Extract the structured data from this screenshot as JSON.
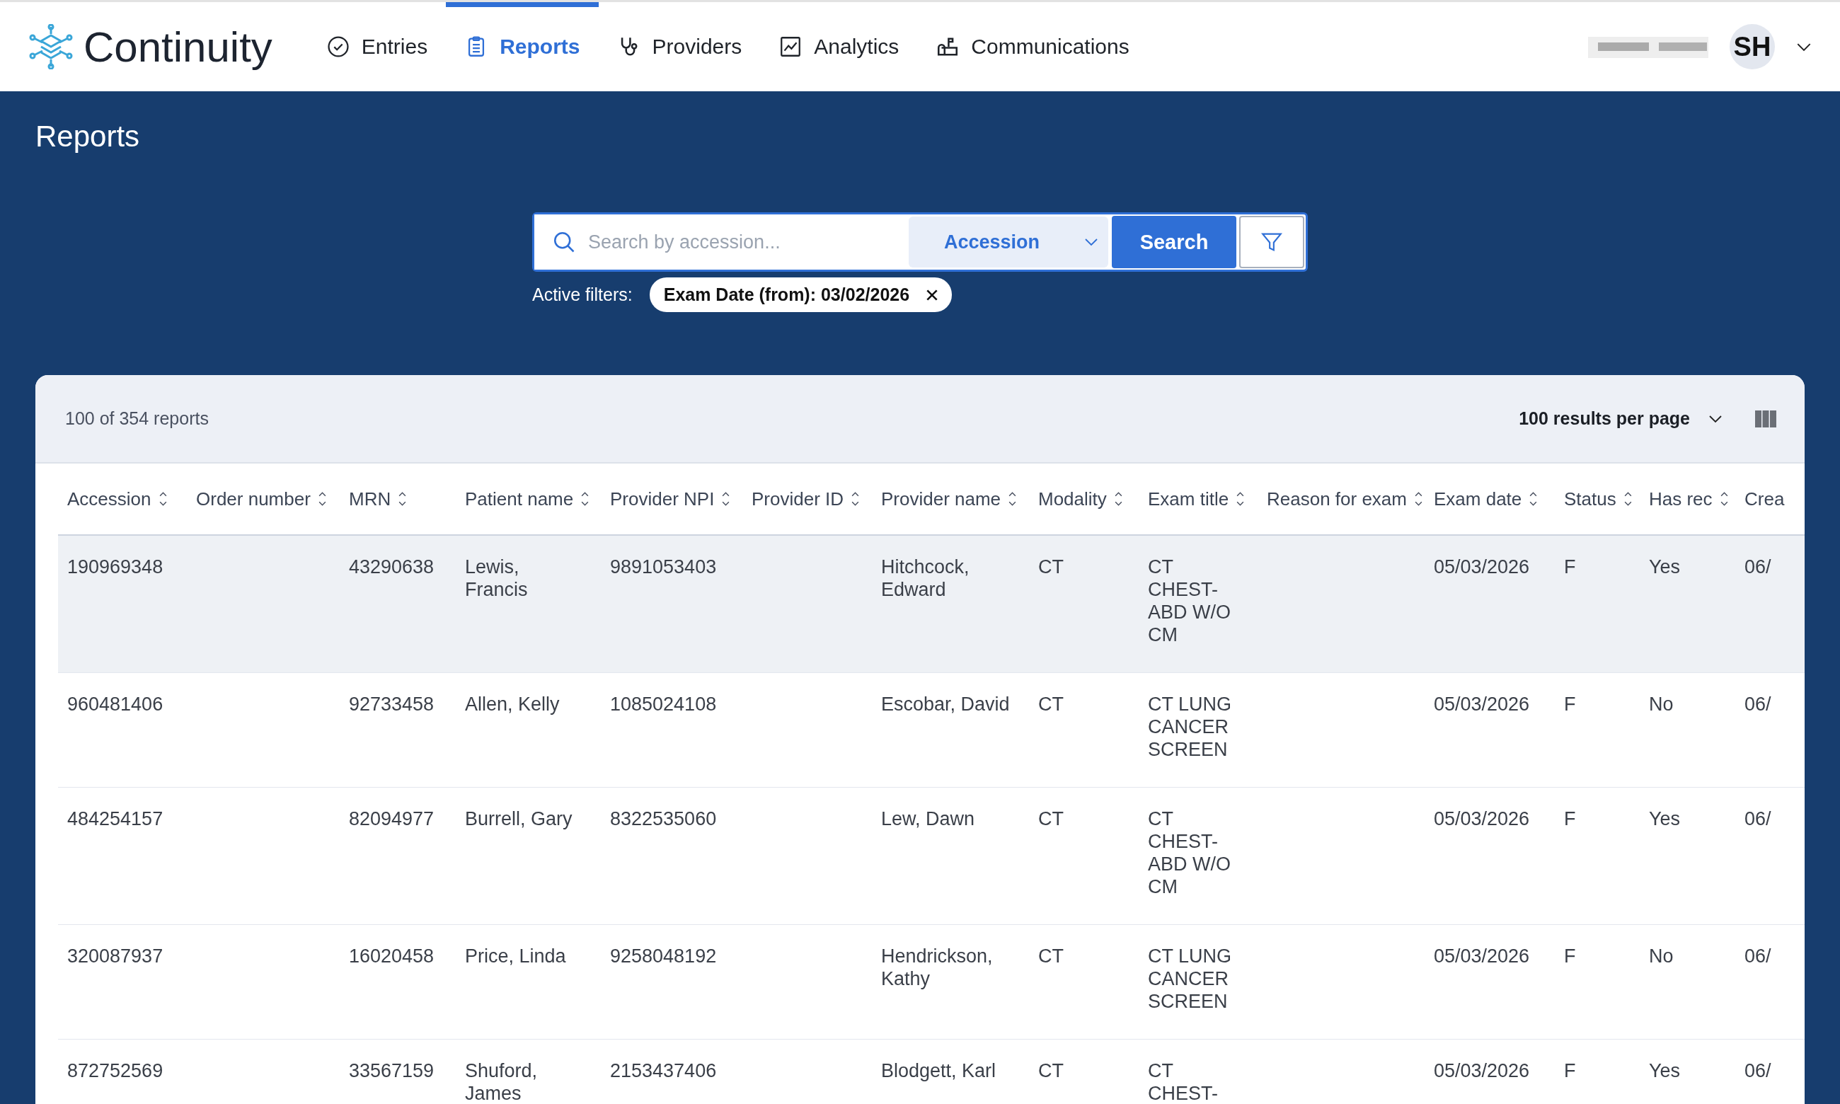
{
  "app": {
    "name": "Continuity",
    "user_initials": "SH"
  },
  "nav": [
    {
      "label": "Entries",
      "kind": "check",
      "selected": false
    },
    {
      "label": "Reports",
      "kind": "clipboard",
      "selected": true
    },
    {
      "label": "Providers",
      "kind": "stethoscope",
      "selected": false
    },
    {
      "label": "Analytics",
      "kind": "chart",
      "selected": false
    },
    {
      "label": "Communications",
      "kind": "mailbox",
      "selected": false
    }
  ],
  "page_title": "Reports",
  "search": {
    "placeholder": "Search by accession...",
    "field_select": "Accession",
    "button": "Search"
  },
  "active_filters": {
    "label": "Active filters:",
    "chips": [
      "Exam Date (from): 03/02/2026"
    ]
  },
  "results": {
    "count": "100 of 354 reports",
    "per_page": "100 results per page"
  },
  "table": {
    "columns": [
      "Accession",
      "Order number",
      "MRN",
      "Patient name",
      "Provider NPI",
      "Provider ID",
      "Provider name",
      "Modality",
      "Exam title",
      "Reason for exam",
      "Exam date",
      "Status",
      "Has rec",
      "Crea"
    ],
    "rows": [
      {
        "hovered": true,
        "accession": "190969348",
        "mrn": "43290638",
        "patient_name": "Lewis, Francis",
        "provider_npi": "9891053403",
        "provider_name": "Hitchcock, Edward",
        "modality": "CT",
        "exam_title": "CT CHEST-ABD W/O CM",
        "exam_date": "05/03/2026",
        "status": "F",
        "has_rec": "Yes",
        "column_14": "06/"
      },
      {
        "hovered": false,
        "accession": "960481406",
        "mrn": "92733458",
        "patient_name": "Allen, Kelly",
        "provider_npi": "1085024108",
        "provider_name": "Escobar, David",
        "modality": "CT",
        "exam_title": "CT LUNG CANCER SCREEN",
        "exam_date": "05/03/2026",
        "status": "F",
        "has_rec": "No",
        "column_14": "06/"
      },
      {
        "hovered": false,
        "accession": "484254157",
        "mrn": "82094977",
        "patient_name": "Burrell, Gary",
        "provider_npi": "8322535060",
        "provider_name": "Lew, Dawn",
        "modality": "CT",
        "exam_title": "CT CHEST-ABD W/O CM",
        "exam_date": "05/03/2026",
        "status": "F",
        "has_rec": "Yes",
        "column_14": "06/"
      },
      {
        "hovered": false,
        "accession": "320087937",
        "mrn": "16020458",
        "patient_name": "Price, Linda",
        "provider_npi": "9258048192",
        "provider_name": "Hendrickson, Kathy",
        "modality": "CT",
        "exam_title": "CT LUNG CANCER SCREEN",
        "exam_date": "05/03/2026",
        "status": "F",
        "has_rec": "No",
        "column_14": "06/"
      },
      {
        "hovered": false,
        "accession": "872752569",
        "mrn": "33567159",
        "patient_name": "Shuford, James",
        "provider_npi": "2153437406",
        "provider_name": "Blodgett, Karl",
        "modality": "CT",
        "exam_title": "CT CHEST-",
        "exam_date": "05/03/2026",
        "status": "F",
        "has_rec": "Yes",
        "column_14": "06/"
      }
    ]
  }
}
